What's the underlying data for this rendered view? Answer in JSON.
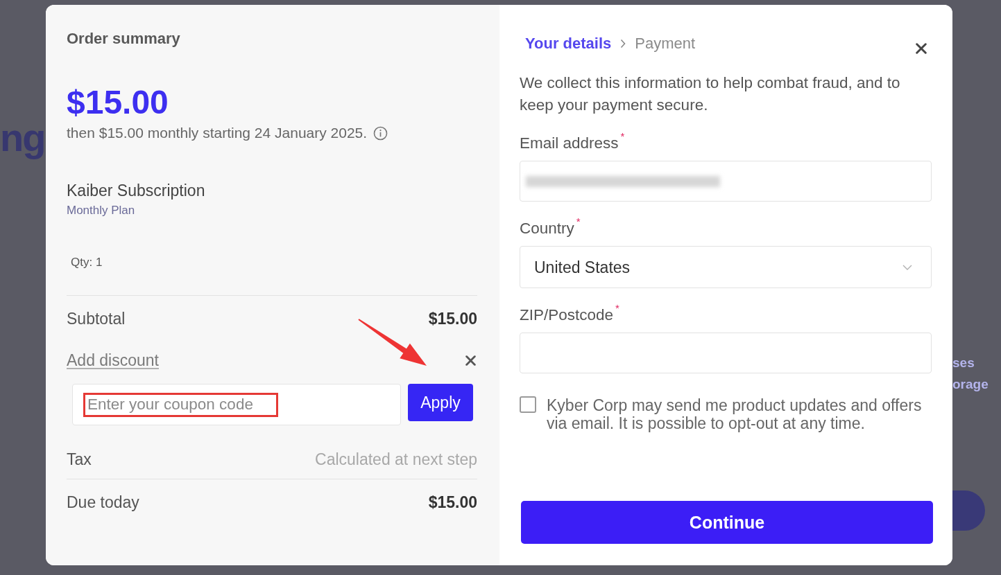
{
  "backdrop": {
    "heading_fragment": "ng",
    "text_fragments": [
      "ses",
      "orage"
    ]
  },
  "order_summary": {
    "title": "Order summary",
    "price": "$15.00",
    "price_note": "then $15.00 monthly starting 24 January 2025.",
    "product": {
      "name": "Kaiber Subscription",
      "plan": "Monthly Plan",
      "quantity": "Qty: 1"
    },
    "lines": [
      {
        "kind": "amount",
        "label": "Subtotal",
        "value": "$15.00",
        "divider_above": true
      },
      {
        "kind": "discount",
        "label": "Add discount",
        "placeholder": "Enter your coupon code",
        "button": "Apply",
        "divider_above": false,
        "highlighted": true,
        "pointer_arrow": true
      },
      {
        "kind": "note",
        "label": "Tax",
        "value": "Calculated at next step",
        "divider_above": false
      },
      {
        "kind": "amount",
        "label": "Due today",
        "value": "$15.00",
        "divider_above": true
      }
    ]
  },
  "details": {
    "steps": [
      {
        "label": "Your details",
        "selected": true
      },
      {
        "label": "Payment",
        "selected": false
      }
    ],
    "intro": "We collect this information to help combat fraud, and to keep your payment secure.",
    "fields": [
      {
        "kind": "text",
        "label": "Email address",
        "required_mark": "*",
        "redacted": true
      },
      {
        "kind": "select",
        "label": "Country",
        "required_mark": "*",
        "value": "United States"
      },
      {
        "kind": "text",
        "label": "ZIP/Postcode",
        "required_mark": "*",
        "redacted": false
      }
    ],
    "consent": {
      "label": "Kyber Corp may send me product updates and offers via email. It is possible to opt-out at any time.",
      "checked": false
    },
    "submit": "Continue"
  }
}
